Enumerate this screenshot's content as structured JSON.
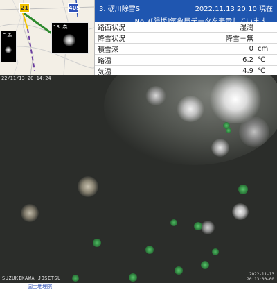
{
  "map": {
    "route_signs": [
      "21",
      "405"
    ],
    "thumbnails": {
      "left_label": "白馬",
      "main_label": "13. 森"
    }
  },
  "panel": {
    "title": "3. 砺川除雪S",
    "datetime": "2022.11.13 20:10 現在",
    "subtitle": "No.3[陽坂]気象局データを表示しています。",
    "rows": [
      {
        "label": "路面状況",
        "value": "湿潤",
        "unit": ""
      },
      {
        "label": "降雪状況",
        "value": "降雪－無",
        "unit": ""
      },
      {
        "label": "積雪深",
        "value": "0",
        "unit": "cm"
      },
      {
        "label": "路温",
        "value": "6.2",
        "unit": "℃"
      },
      {
        "label": "気温",
        "value": "4.9",
        "unit": "℃"
      }
    ]
  },
  "camera": {
    "timestamp_top": "22/11/13 20:14:24",
    "location_caption": "SUZUKIKAWA JOSETSU",
    "timestamp_bottom_line1": "2022-11-13",
    "timestamp_bottom_line2": "20:13:00-00"
  },
  "footer": {
    "text": "国土地理院"
  },
  "colors": {
    "header_blue": "#1f56b0",
    "highlight_red": "#d41c1c",
    "map_route_green": "#2d8a2d",
    "snow_green": "#3aa84a"
  }
}
